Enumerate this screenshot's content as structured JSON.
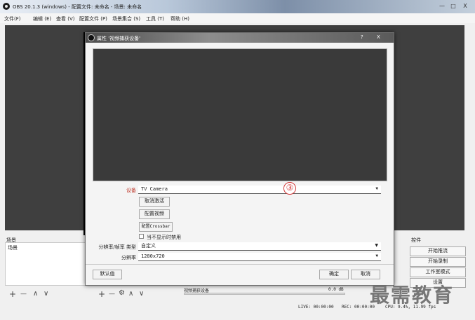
{
  "window": {
    "title": "OBS 20.1.3 (windows) - 配置文件: 未命名 - 场景: 未命名",
    "min": "—",
    "max": "□",
    "close": "X"
  },
  "menu": [
    "文件(F)",
    "编辑 (E)",
    "查看 (V)",
    "配置文件 (P)",
    "场景集合 (S)",
    "工具 (T)",
    "帮助 (H)"
  ],
  "scenes": {
    "header": "场景",
    "list_header": "场景",
    "add": "+",
    "remove": "—",
    "up": "∧",
    "down": "∨"
  },
  "sources": {
    "add": "+",
    "remove": "—",
    "settings": "⚙",
    "up": "∧",
    "down": "∨"
  },
  "mixer": {
    "source": "视频捕获设备",
    "level": "0.0 dB"
  },
  "controls": {
    "header": "控件",
    "start_stream": "开始推流",
    "start_record": "开始录制",
    "studio_mode": "工作室模式",
    "settings": "设置"
  },
  "status": {
    "live": "LIVE: 00:00:00",
    "rec": "REC: 00:00:00",
    "cpu": "CPU: 9.4%, 11.99 fps"
  },
  "dialog": {
    "title": "属性 '视频捕获设备'",
    "help": "?",
    "close": "X",
    "device_label": "设备",
    "device_value": "TV Camera",
    "deactivate_btn": "取消激活",
    "config_video_btn": "配置视频",
    "config_crossbar_btn": "配置Crossbar",
    "hide_checkbox_label": "当不显示时禁用",
    "res_type_label": "分辨率/帧率 类型",
    "res_type_value": "自定义",
    "resolution_label": "分辨率",
    "resolution_value": "1280x720",
    "defaults_btn": "默认值",
    "ok_btn": "确定",
    "cancel_btn": "取消",
    "marker": "③"
  },
  "watermark": "最需教育"
}
